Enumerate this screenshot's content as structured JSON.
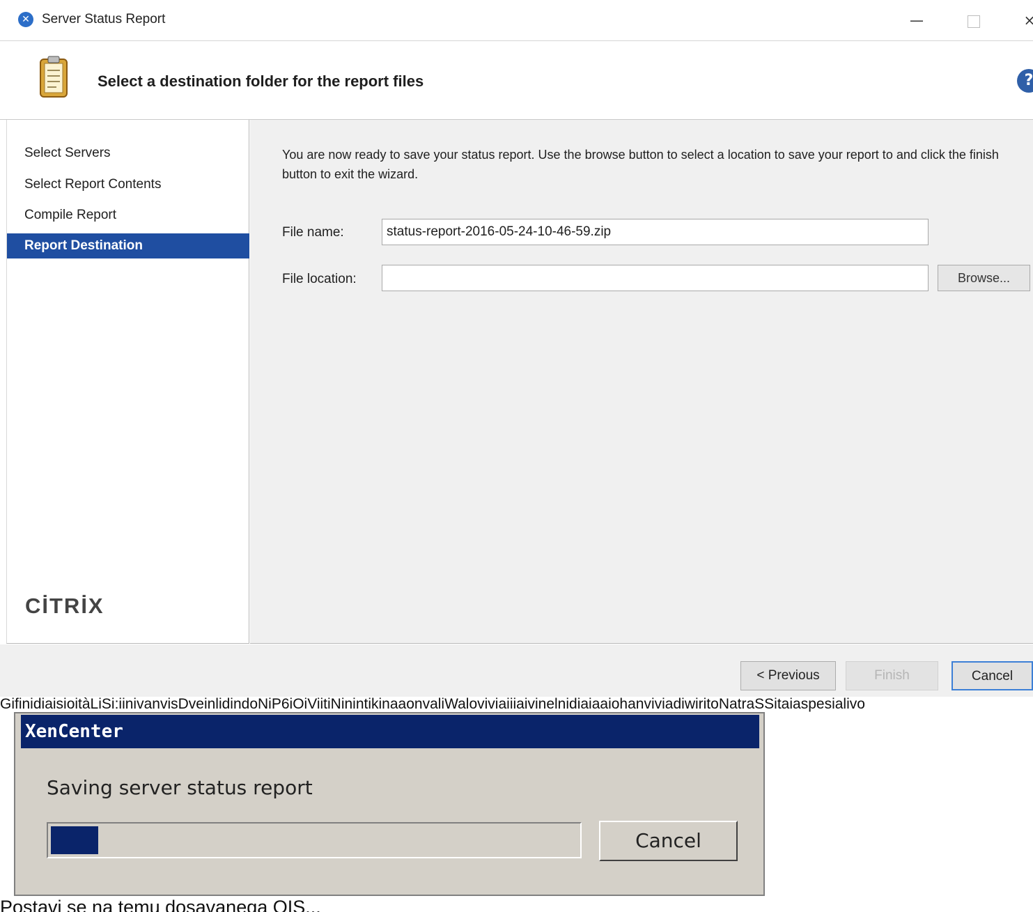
{
  "window": {
    "title": "Server Status Report",
    "minimize_glyph": "—",
    "close_glyph": "×"
  },
  "header": {
    "title": "Select a destination folder for the report files",
    "help_glyph": "?"
  },
  "sidebar": {
    "steps": [
      {
        "label": "Select Servers",
        "active": false
      },
      {
        "label": "Select Report Contents",
        "active": false
      },
      {
        "label": "Compile Report",
        "active": false
      },
      {
        "label": "Report Destination",
        "active": true
      }
    ],
    "logo": "CİTRİX"
  },
  "content": {
    "intro": "You are now ready to save your status report. Use the browse button to select a location to save your report to and click the finish button to exit the wizard.",
    "file_name_label": "File name:",
    "file_name_value": "status-report-2016-05-24-10-46-59.zip",
    "file_location_label": "File location:",
    "file_location_value": "",
    "browse_label": "Browse..."
  },
  "footer": {
    "previous_label": "< Previous",
    "finish_label": "Finish",
    "cancel_label": "Cancel"
  },
  "overlay_text": "GifinidiaisioitàLiSi:iinivanvisDveinlidindoNiP6iOiViitiNinintikinaaonvaliWaloviviaiiiaivinelnidiaiaaiohanviviadiwiritoNatraSSitaiaspesialivo",
  "dialog": {
    "title": "XenCenter",
    "message": "Saving server status report",
    "progress_fraction": 0.09,
    "cancel_label": "Cancel"
  },
  "caption": "Postavi se na temu dosavanega OIS..."
}
